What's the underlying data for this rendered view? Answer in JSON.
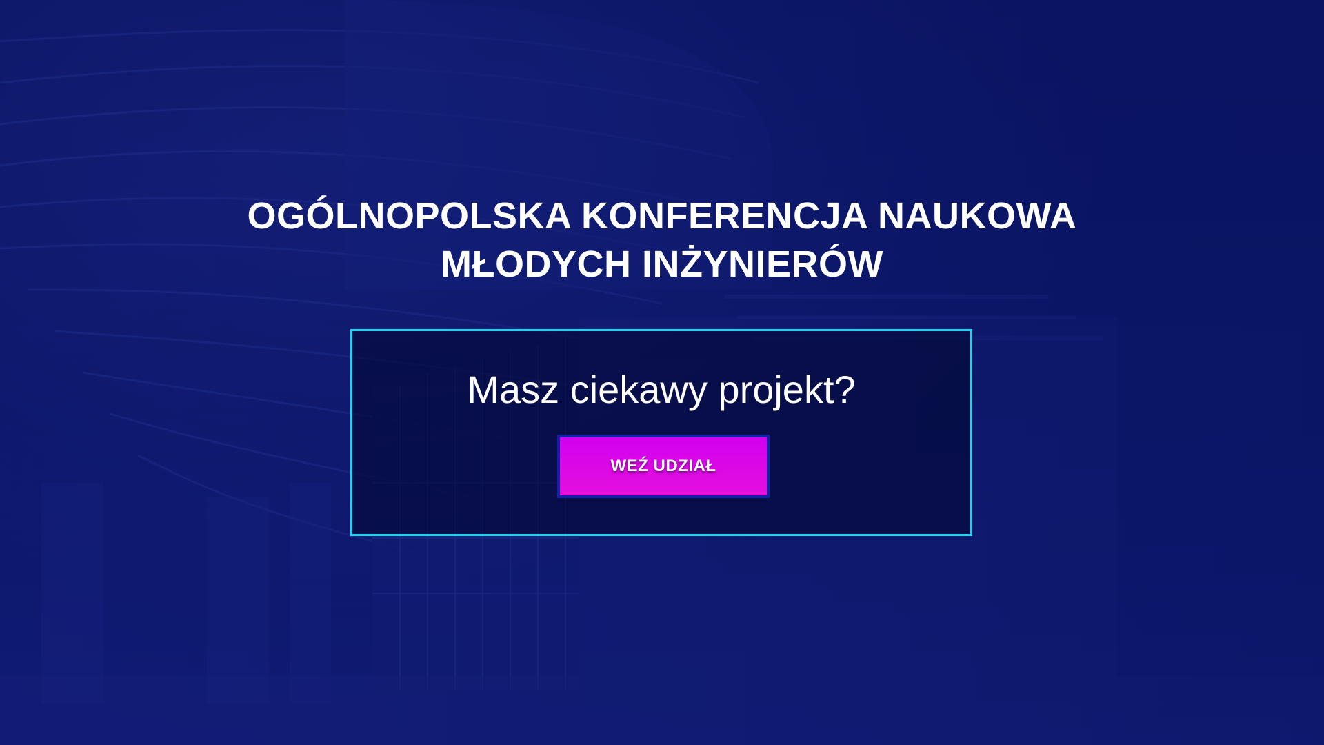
{
  "hero": {
    "title_line1": "OGÓLNOPOLSKA KONFERENCJA NAUKOWA",
    "title_line2": "MŁODYCH INŻYNIERÓW",
    "question": "Masz ciekawy projekt?",
    "cta_label": "WEŹ UDZIAŁ"
  },
  "colors": {
    "background": "#0b1566",
    "box_border": "#19d6ee",
    "button": "#d100f0",
    "button_border": "#1320a8",
    "text": "#ffffff"
  }
}
